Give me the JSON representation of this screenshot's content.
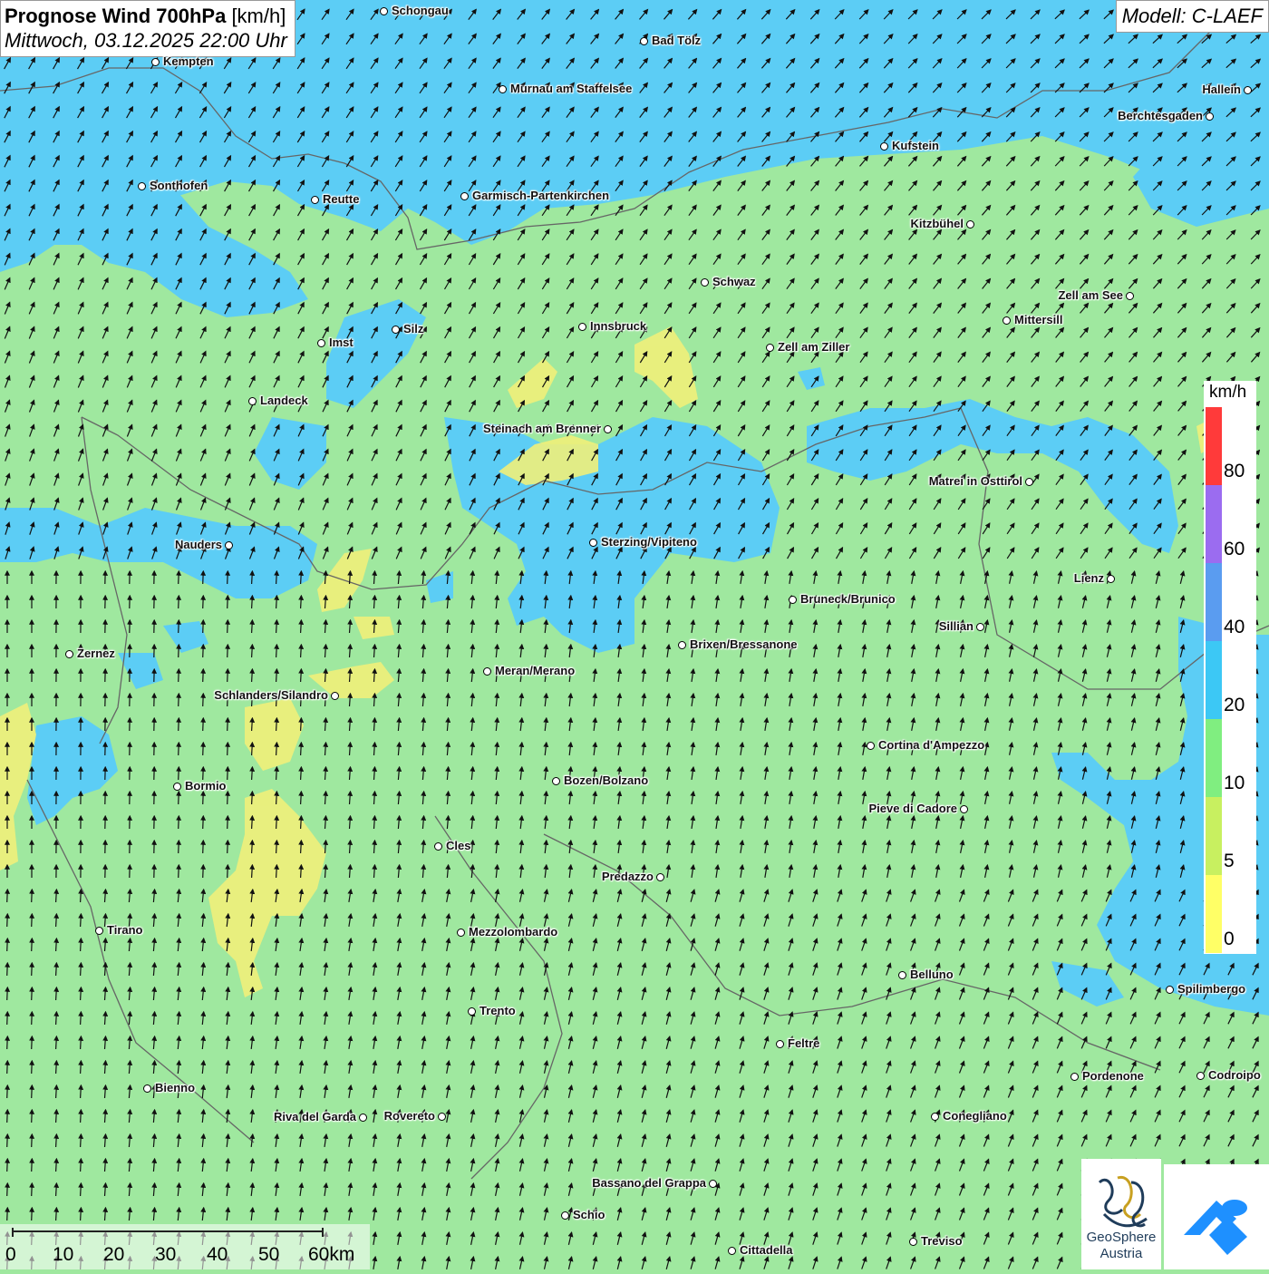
{
  "header": {
    "title_bold": "Prognose Wind 700hPa",
    "title_unit": "[km/h]",
    "datetime": "Mittwoch, 03.12.2025 22:00 Uhr",
    "model": "Modell: C-LAEF"
  },
  "legend": {
    "unit": "km/h",
    "classes": [
      {
        "label": "0",
        "color": "#ffff66"
      },
      {
        "label": "5",
        "color": "#c8f060"
      },
      {
        "label": "10",
        "color": "#80ee80"
      },
      {
        "label": "20",
        "color": "#3cc8f5"
      },
      {
        "label": "40",
        "color": "#5a9cf0"
      },
      {
        "label": "60",
        "color": "#9b6cf0"
      },
      {
        "label": "80",
        "color": "#ff3a3a"
      }
    ]
  },
  "scalebar": {
    "labels": [
      "0",
      "10",
      "20",
      "30",
      "40",
      "50",
      "60km"
    ]
  },
  "cities": [
    {
      "name": "Schongau"
    },
    {
      "name": "Bad Tölz"
    },
    {
      "name": "Kempten"
    },
    {
      "name": "Murnau am Staffelsee"
    },
    {
      "name": "Hallein"
    },
    {
      "name": "Berchtesgaden"
    },
    {
      "name": "Kufstein"
    },
    {
      "name": "Sonthofen"
    },
    {
      "name": "Reutte"
    },
    {
      "name": "Garmisch-Partenkirchen"
    },
    {
      "name": "Kitzbühel"
    },
    {
      "name": "Schwaz"
    },
    {
      "name": "Zell am See"
    },
    {
      "name": "Mittersill"
    },
    {
      "name": "Innsbruck"
    },
    {
      "name": "Silz"
    },
    {
      "name": "Imst"
    },
    {
      "name": "Zell am Ziller"
    },
    {
      "name": "Landeck"
    },
    {
      "name": "Steinach am Brenner"
    },
    {
      "name": "Matrei in Osttirol"
    },
    {
      "name": "Nauders"
    },
    {
      "name": "Sterzing/Vipiteno"
    },
    {
      "name": "Lienz"
    },
    {
      "name": "Bruneck/Brunico"
    },
    {
      "name": "Sillian"
    },
    {
      "name": "Zernez"
    },
    {
      "name": "Brixen/Bressanone"
    },
    {
      "name": "Meran/Merano"
    },
    {
      "name": "Schlanders/Silandro"
    },
    {
      "name": "Cortina d'Ampezzo"
    },
    {
      "name": "Bozen/Bolzano"
    },
    {
      "name": "Bormio"
    },
    {
      "name": "Pieve di Cadore"
    },
    {
      "name": "Cles"
    },
    {
      "name": "Predazzo"
    },
    {
      "name": "Tirano"
    },
    {
      "name": "Mezzolombardo"
    },
    {
      "name": "Belluno"
    },
    {
      "name": "Spilimbergo"
    },
    {
      "name": "Trento"
    },
    {
      "name": "Feltre"
    },
    {
      "name": "Pordenone"
    },
    {
      "name": "Codroipo"
    },
    {
      "name": "Bienno"
    },
    {
      "name": "Riva del Garda"
    },
    {
      "name": "Rovereto"
    },
    {
      "name": "Conegliano"
    },
    {
      "name": "Bassano del Grappa"
    },
    {
      "name": "Schio"
    },
    {
      "name": "Treviso"
    },
    {
      "name": "Cittadella"
    }
  ],
  "logos": {
    "geosphere_line1": "GeoSphere",
    "geosphere_line2": "Austria"
  }
}
